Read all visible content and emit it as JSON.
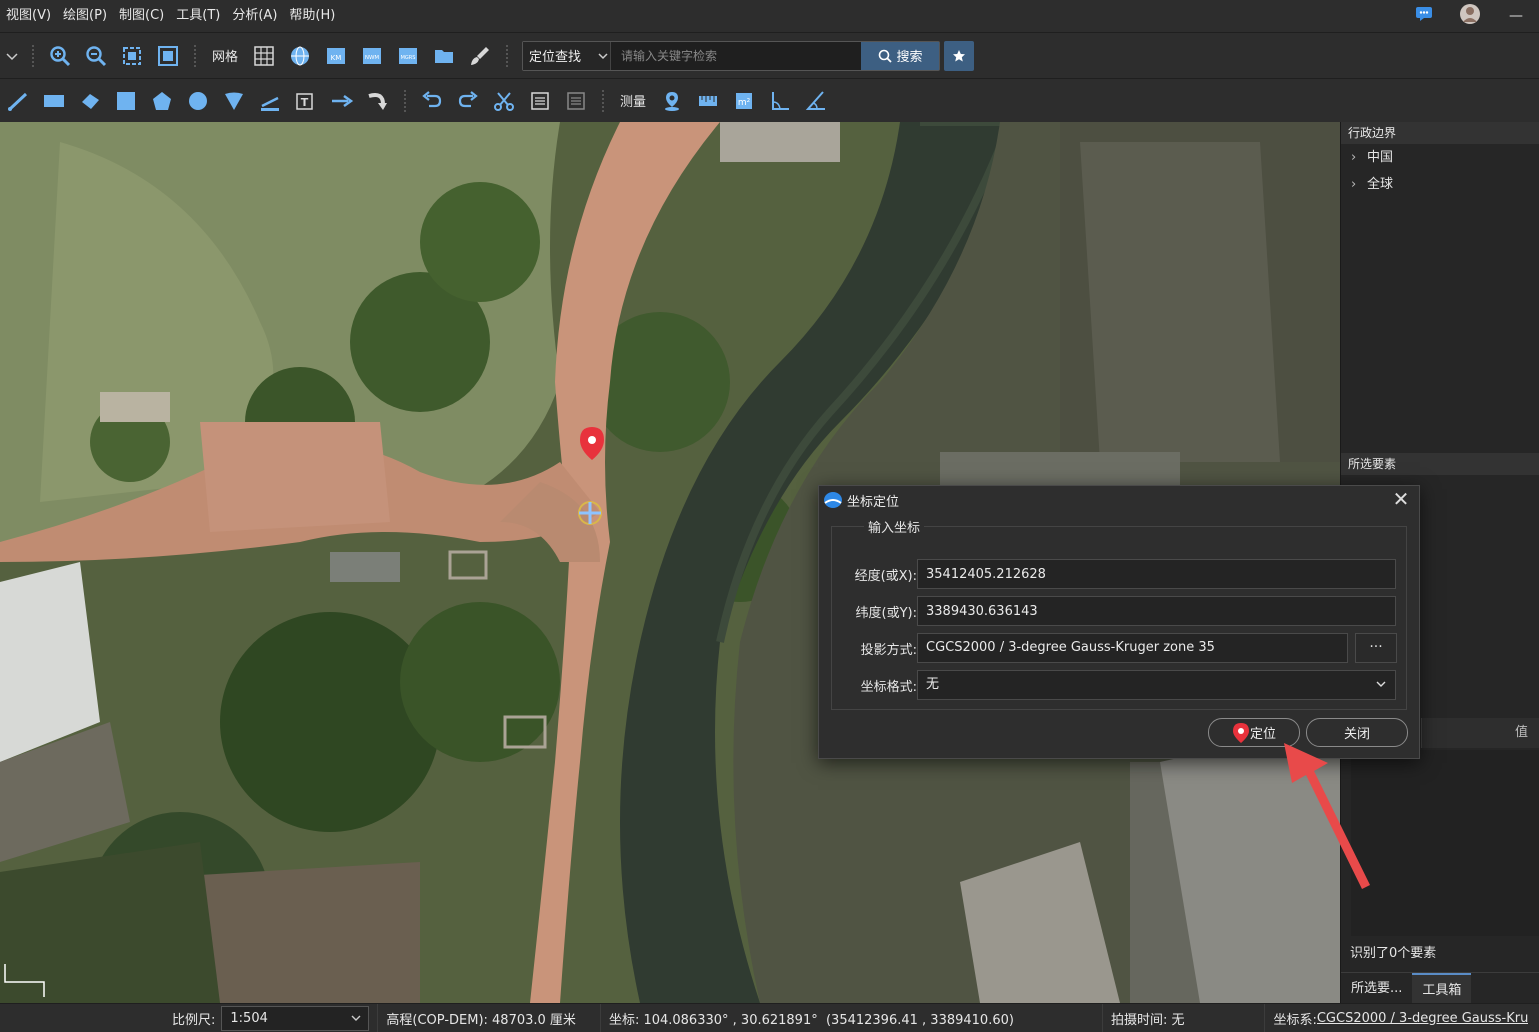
{
  "menubar": {
    "items": [
      "视图(V)",
      "绘图(P)",
      "制图(C)",
      "工具(T)",
      "分析(A)",
      "帮助(H)"
    ]
  },
  "toolbar1": {
    "grid_label": "网格",
    "search_type": "定位查找",
    "search_placeholder": "请输入关键字检索",
    "search_button": "搜索"
  },
  "toolbar2": {
    "measure_label": "测量"
  },
  "right_panel": {
    "boundary_header": "行政边界",
    "boundary_items": [
      "中国",
      "全球"
    ],
    "selected_header": "所选要素",
    "value_header": "值",
    "recognized_text": "识别了0个要素",
    "tabs": [
      "所选要...",
      "工具箱"
    ]
  },
  "dialog": {
    "title": "坐标定位",
    "group_title": "输入坐标",
    "lon_label": "经度(或X):",
    "lon_value": "35412405.212628",
    "lat_label": "纬度(或Y):",
    "lat_value": "3389430.636143",
    "proj_label": "投影方式:",
    "proj_value": "CGCS2000 / 3-degree Gauss-Kruger zone 35",
    "proj_more": "···",
    "format_label": "坐标格式:",
    "format_value": "无",
    "locate_button": "定位",
    "close_button": "关闭"
  },
  "statusbar": {
    "scale_label": "比例尺:",
    "scale_value": "1:504",
    "elevation": "高程(COP-DEM): 48703.0 厘米",
    "coords": "坐标: 104.086330° , 30.621891°  (35412396.41 , 3389410.60)",
    "capture_time": "拍摄时间: 无",
    "crs_label": "坐标系:",
    "crs_value": "CGCS2000 / 3-degree Gauss-Kru"
  },
  "colors": {
    "accent": "#3d5f82",
    "marker_red": "#e8323c",
    "arrow_red": "#e84a4a"
  }
}
